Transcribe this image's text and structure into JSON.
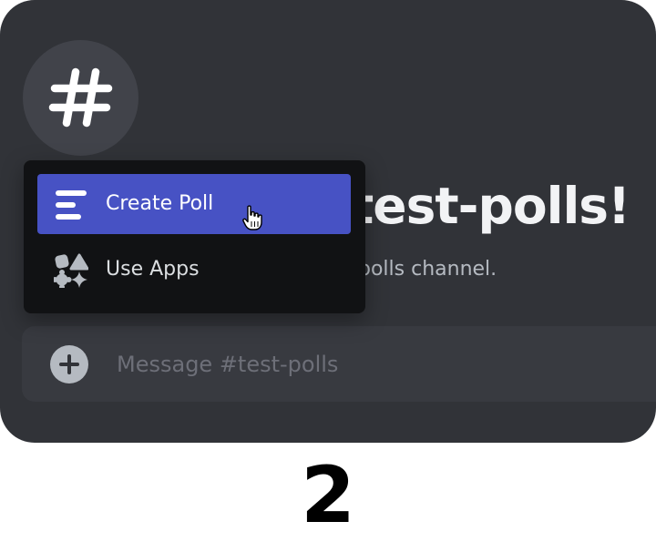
{
  "channel": {
    "icon": "hash-icon",
    "welcome_title_visible": "test-polls!",
    "welcome_subtitle_visible": "polls channel."
  },
  "composer": {
    "add_icon": "plus-circle-icon",
    "placeholder": "Message #test-polls"
  },
  "popup_menu": {
    "items": [
      {
        "label": "Create Poll",
        "icon": "poll-icon",
        "highlighted": true
      },
      {
        "label": "Use Apps",
        "icon": "apps-icon",
        "highlighted": false
      }
    ]
  },
  "step_label": "2",
  "colors": {
    "background": "#313338",
    "composer": "#383a40",
    "popup": "#111214",
    "highlight": "#4752c4"
  }
}
